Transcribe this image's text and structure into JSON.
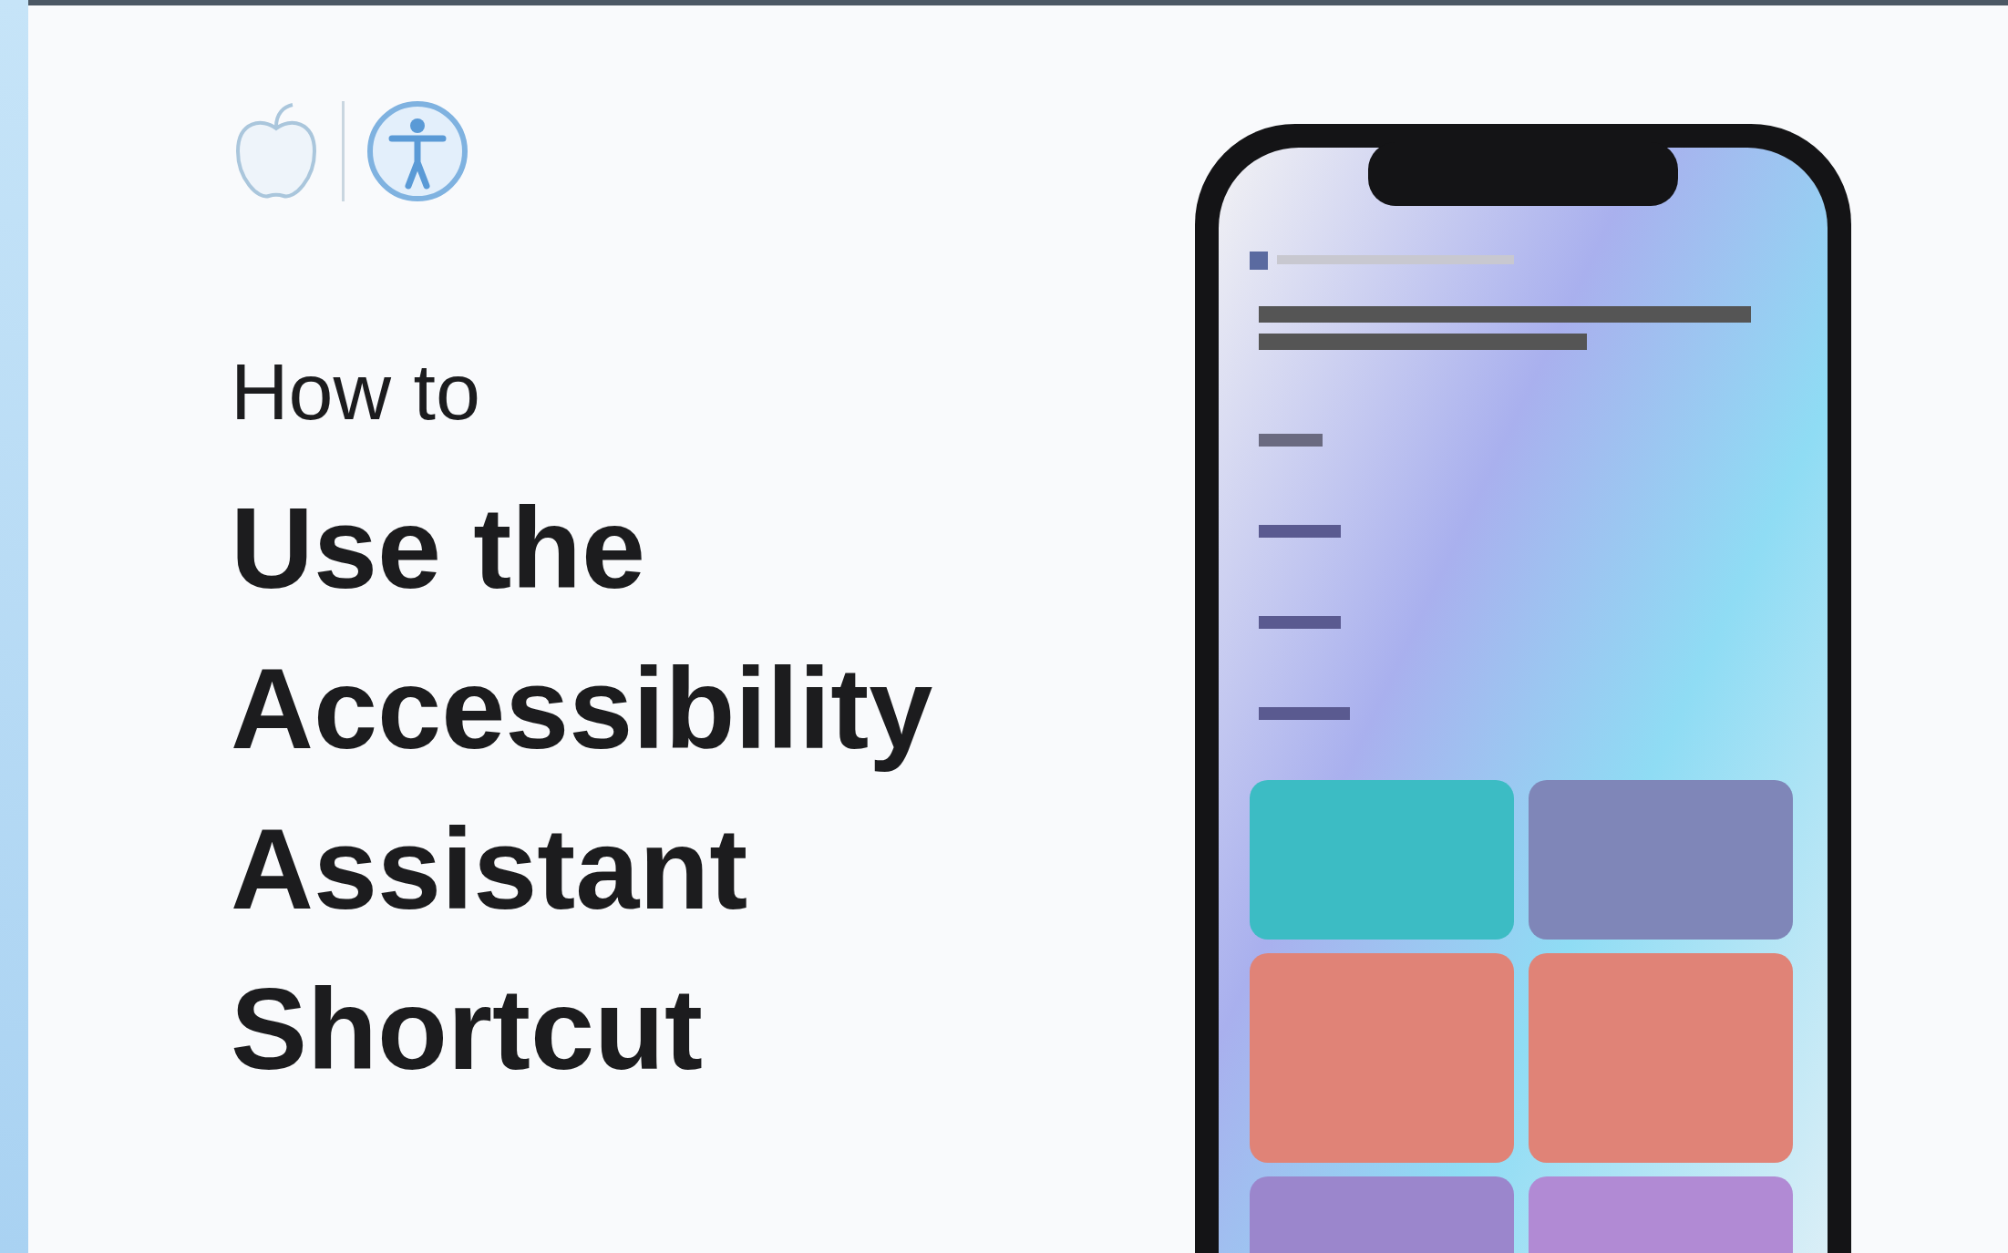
{
  "subtitle": "How to",
  "heading_lines": [
    "Use the",
    "Accessibility",
    "Assistant",
    "Shortcut"
  ]
}
